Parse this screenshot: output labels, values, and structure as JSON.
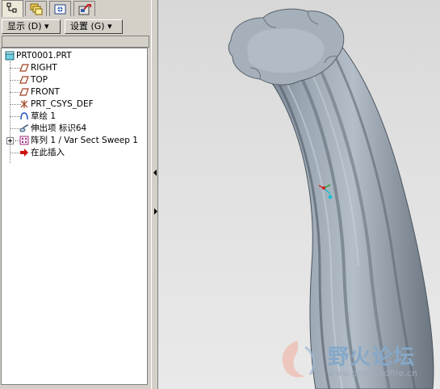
{
  "tabs": [
    {
      "icon": "model-tree-icon"
    },
    {
      "icon": "layers-icon"
    },
    {
      "icon": "favorites-icon"
    },
    {
      "icon": "connections-icon"
    }
  ],
  "toolbar": {
    "show_label": "显示 (D) ▾",
    "settings_label": "设置 (G) ▾"
  },
  "tree": {
    "root": "PRT0001.PRT",
    "items": [
      {
        "label": "RIGHT",
        "icon": "datum-plane-icon"
      },
      {
        "label": "TOP",
        "icon": "datum-plane-icon"
      },
      {
        "label": "FRONT",
        "icon": "datum-plane-icon"
      },
      {
        "label": "PRT_CSYS_DEF",
        "icon": "csys-icon"
      },
      {
        "label": "草绘 1",
        "icon": "sketch-icon"
      },
      {
        "label": "伸出项 标识64",
        "icon": "protrusion-icon"
      },
      {
        "label": "阵列 1 / Var Sect Sweep 1",
        "icon": "pattern-icon"
      },
      {
        "label": "在此插入",
        "icon": "insert-here-icon"
      }
    ]
  },
  "watermark": {
    "title": "野火论坛",
    "url": "www.proewildfire.cn"
  },
  "colors": {
    "model_base": "#8c98a4",
    "model_light": "#b4bec8",
    "insert_arrow": "#d01010"
  }
}
